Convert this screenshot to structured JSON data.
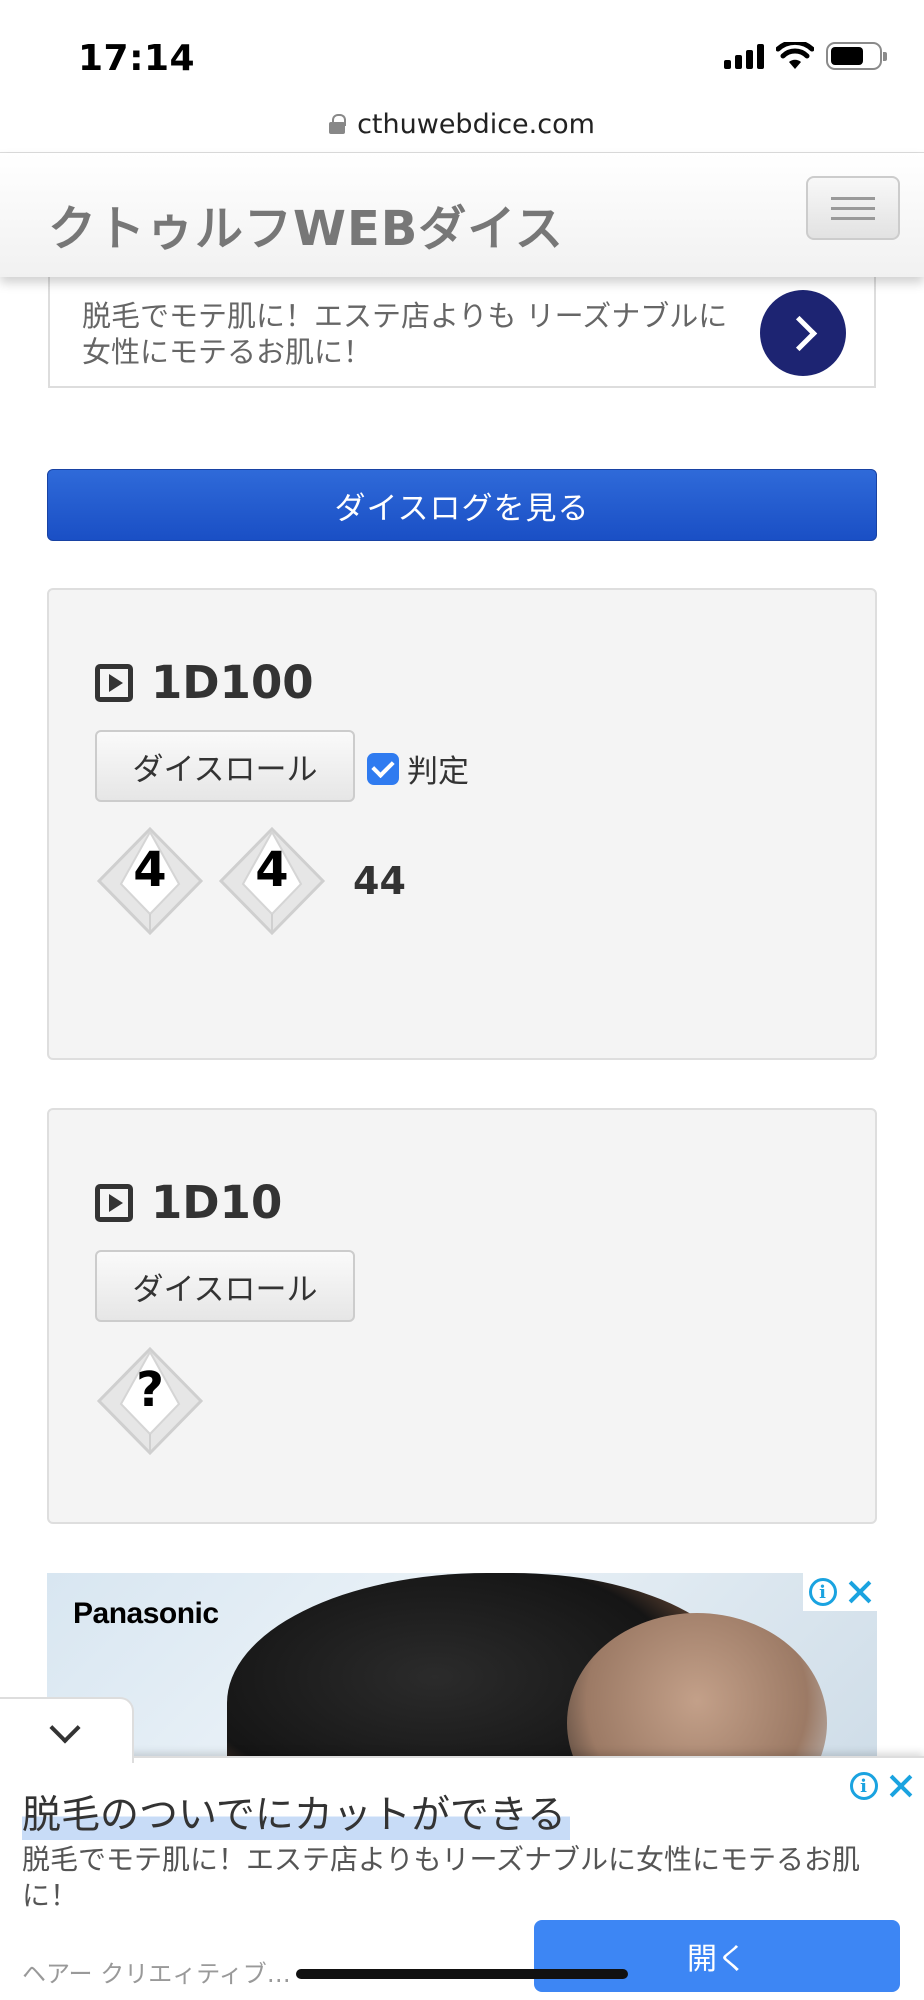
{
  "status_bar": {
    "time": "17:14",
    "battery_level": 0.7
  },
  "browser": {
    "url": "cthuwebdice.com"
  },
  "header": {
    "title": "クトゥルフWEBダイス"
  },
  "top_ad": {
    "text": "脱毛でモテ肌に！エステ店よりも リーズナブルに女性にモテるお肌に！"
  },
  "dice_log_button": "ダイスログを見る",
  "panels": [
    {
      "title": "1D100",
      "roll_label": "ダイスロール",
      "judge_label": "判定",
      "judge_checked": true,
      "dice": [
        "4",
        "4"
      ],
      "total": "44"
    },
    {
      "title": "1D10",
      "roll_label": "ダイスロール",
      "dice": [
        "?"
      ]
    }
  ],
  "image_ad": {
    "brand": "Panasonic"
  },
  "anchor_ad": {
    "title": "脱毛のついでにカットができる",
    "text": "脱毛でモテ肌に！エステ店よりもリーズナブルに女性にモテるお肌に！",
    "source": "ヘアー クリエィティブ…",
    "open_label": "開く"
  },
  "colors": {
    "accent_blue": "#1a4fc5",
    "ad_button": "#1d2472",
    "open_button": "#3d86f4",
    "checkbox": "#2f7bf0"
  }
}
